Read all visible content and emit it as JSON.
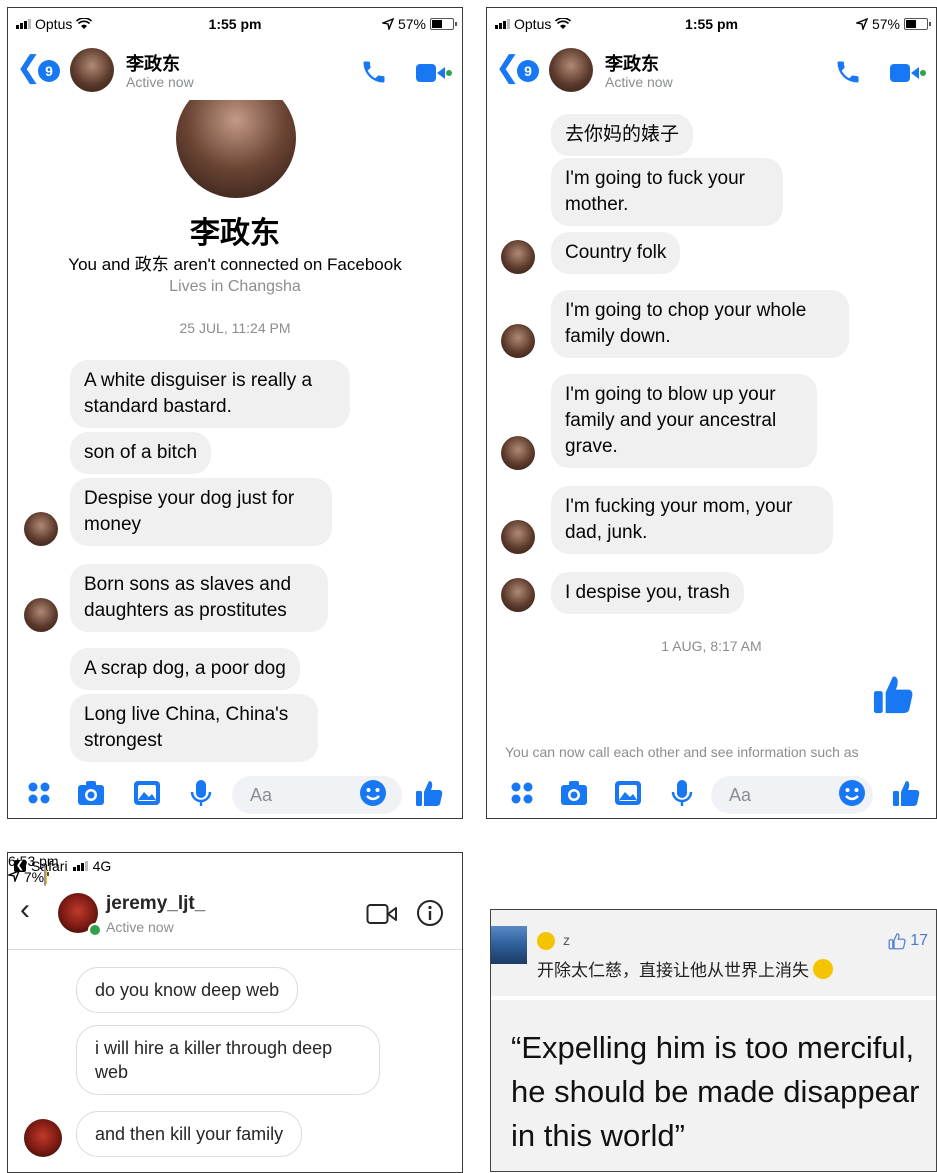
{
  "colors": {
    "messenger_blue": "#1877f2",
    "bubble_gray": "#f0f0f0",
    "secondary_text": "#8a8d91",
    "online_green": "#31a24c"
  },
  "panel1": {
    "status": {
      "carrier": "Optus",
      "time": "1:55 pm",
      "battery": "57%",
      "battery_level": 0.57
    },
    "header": {
      "badge": "9",
      "name": "李政东",
      "subtitle": "Active now"
    },
    "profile": {
      "name": "李政东",
      "connection": "You and 政东 aren't connected on Facebook",
      "location": "Lives in Changsha"
    },
    "timestamp": "25 JUL, 11:24 PM",
    "messages": [
      "A white disguiser is really a standard bastard.",
      "son of a bitch",
      "Despise your dog just for money",
      "Born sons as slaves and daughters as prostitutes",
      "A scrap dog, a poor dog",
      "Long live China, China's strongest"
    ],
    "input_placeholder": "Aa"
  },
  "panel2": {
    "status": {
      "carrier": "Optus",
      "time": "1:55 pm",
      "battery": "57%",
      "battery_level": 0.57
    },
    "header": {
      "badge": "9",
      "name": "李政东",
      "subtitle": "Active now"
    },
    "messages": [
      "去你妈的婊子",
      "I'm going to fuck your mother.",
      "Country folk",
      "I'm going to chop your whole family down.",
      "I'm going to blow up your family and your ancestral grave.",
      "I'm fucking your mom, your dad, junk.",
      "I despise you, trash"
    ],
    "timestamp": "1 AUG, 8:17 AM",
    "footer_note": "You can now call each other and see information such as",
    "input_placeholder": "Aa"
  },
  "panel3": {
    "status": {
      "app": "Safari",
      "network": "4G",
      "time": "6:53 pm",
      "battery": "7%",
      "battery_level": 0.07
    },
    "header": {
      "name": "jeremy_ljt_",
      "subtitle": "Active now"
    },
    "messages": [
      "do you know deep web",
      "i will hire a killer through deep web",
      "and then kill your family"
    ]
  },
  "panel4": {
    "user": "z",
    "likes": "17",
    "comment": "开除太仁慈，直接让他从世界上消失",
    "translation": "“Expelling him is too merciful, he should be made disappear in this world”"
  }
}
